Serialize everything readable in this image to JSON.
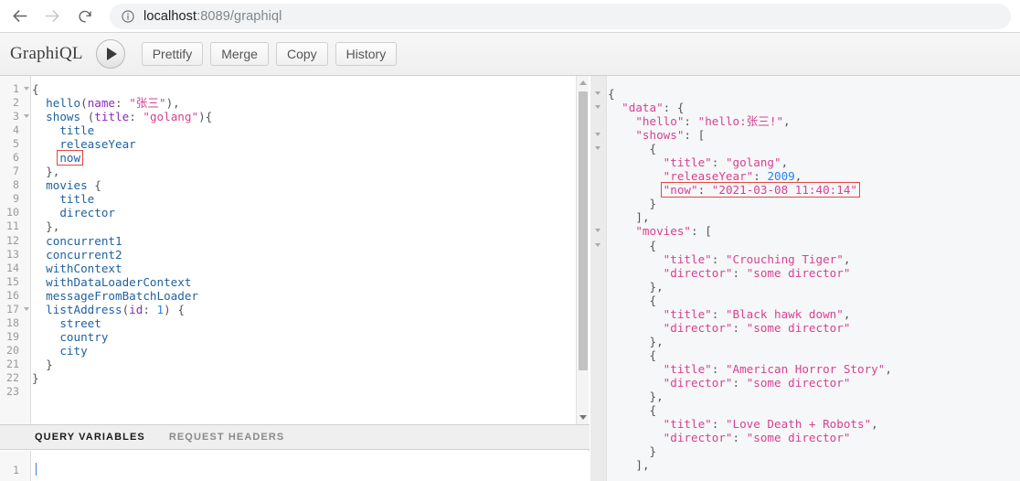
{
  "browser": {
    "back_icon": "arrow-left-icon",
    "forward_icon": "arrow-right-icon",
    "reload_icon": "reload-icon",
    "info_icon": "info-circle-icon",
    "url_host": "localhost",
    "url_rest": ":8089/graphiql",
    "url_full": "localhost:8089/graphiql"
  },
  "graphiql": {
    "logo": "GraphiQL",
    "execute_icon": "play-icon",
    "buttons": [
      {
        "label": "Prettify",
        "name": "prettify-button"
      },
      {
        "label": "Merge",
        "name": "merge-button"
      },
      {
        "label": "Copy",
        "name": "copy-button"
      },
      {
        "label": "History",
        "name": "history-button"
      }
    ]
  },
  "query_editor": {
    "line_numbers": [
      "1",
      "2",
      "3",
      "4",
      "5",
      "6",
      "7",
      "8",
      "9",
      "10",
      "11",
      "12",
      "13",
      "14",
      "15",
      "16",
      "17",
      "18",
      "19",
      "20",
      "21",
      "22",
      "23"
    ],
    "fold_lines": [
      1,
      3,
      17
    ],
    "lines": [
      "{",
      "  hello(name: \"张三\"),",
      "  shows (title: \"golang\"){",
      "    title",
      "    releaseYear",
      "    now",
      "  },",
      "  movies {",
      "    title",
      "    director",
      "  },",
      "  concurrent1",
      "  concurrent2",
      "  withContext",
      "  withDataLoaderContext",
      "  messageFromBatchLoader",
      "  listAddress(id: 1) {",
      "    street",
      "    country",
      "    city",
      "  }",
      "}",
      ""
    ],
    "highlighted_token": "now",
    "highlight_color": "#e8453c"
  },
  "variables_editor": {
    "tabs": [
      {
        "label": "QUERY VARIABLES",
        "active": true
      },
      {
        "label": "REQUEST HEADERS",
        "active": false
      }
    ],
    "line_number": "1",
    "value": ""
  },
  "result_panel": {
    "highlighted_line": "\"now\": \"2021-03-08 11:40:14\"",
    "highlight_color": "#e8453c",
    "lines": [
      "{",
      "  \"data\": {",
      "    \"hello\": \"hello:张三!\",",
      "    \"shows\": [",
      "      {",
      "        \"title\": \"golang\",",
      "        \"releaseYear\": 2009,",
      "        \"now\": \"2021-03-08 11:40:14\"",
      "      }",
      "    ],",
      "    \"movies\": [",
      "      {",
      "        \"title\": \"Crouching Tiger\",",
      "        \"director\": \"some director\"",
      "      },",
      "      {",
      "        \"title\": \"Black hawk down\",",
      "        \"director\": \"some director\"",
      "      },",
      "      {",
      "        \"title\": \"American Horror Story\",",
      "        \"director\": \"some director\"",
      "      },",
      "      {",
      "        \"title\": \"Love Death + Robots\",",
      "        \"director\": \"some director\"",
      "      }",
      "    ],"
    ],
    "fold_rows": [
      0,
      1,
      3,
      4,
      10,
      11
    ]
  },
  "response_data": {
    "data": {
      "hello": "hello:张三!",
      "shows": [
        {
          "title": "golang",
          "releaseYear": 2009,
          "now": "2021-03-08 11:40:14"
        }
      ],
      "movies": [
        {
          "title": "Crouching Tiger",
          "director": "some director"
        },
        {
          "title": "Black hawk down",
          "director": "some director"
        },
        {
          "title": "American Horror Story",
          "director": "some director"
        },
        {
          "title": "Love Death + Robots",
          "director": "some director"
        }
      ]
    }
  },
  "colors": {
    "field": "#1f61a0",
    "argument": "#8b2bb9",
    "string": "#d64292",
    "number": "#2882f9",
    "punctuation": "#555555",
    "accent_red": "#e8453c"
  }
}
